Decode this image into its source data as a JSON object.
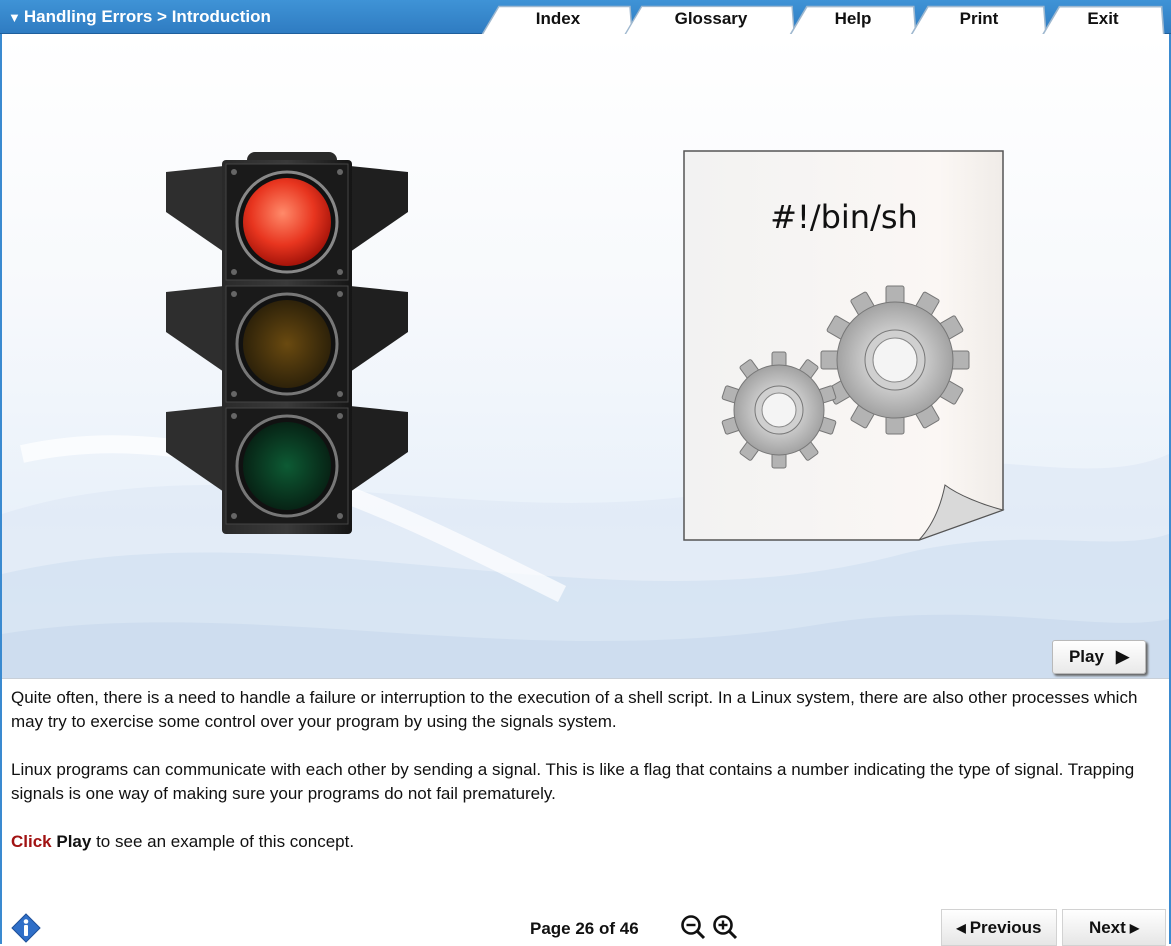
{
  "header": {
    "breadcrumb": "Handling Errors > Introduction",
    "tabs": [
      {
        "label": "Index"
      },
      {
        "label": "Glossary"
      },
      {
        "label": "Help"
      },
      {
        "label": "Print"
      },
      {
        "label": "Exit"
      }
    ]
  },
  "stage": {
    "document_text": "#!/bin/sh",
    "play_label": "Play"
  },
  "content": {
    "para1": "Quite often, there is a need to handle a failure or interruption to the execution of a shell script. In a Linux system, there are also other processes which may try to exercise some control over your program by using the signals system.",
    "para2": "Linux programs can communicate with each other by sending a signal. This is like a flag that contains a number indicating the type of signal. Trapping signals is one way of making sure your programs do not fail prematurely.",
    "instruction": {
      "click": "Click",
      "play": "Play",
      "rest": " to see an example of this concept."
    }
  },
  "footer": {
    "page_label": "Page 26 of 46",
    "previous_label": "Previous",
    "next_label": "Next"
  },
  "colors": {
    "header_blue": "#3a8ad0",
    "click_red": "#a11212"
  },
  "icons": [
    "info-icon",
    "zoom-out-icon",
    "zoom-in-icon",
    "traffic-light-icon",
    "gears-icon"
  ]
}
